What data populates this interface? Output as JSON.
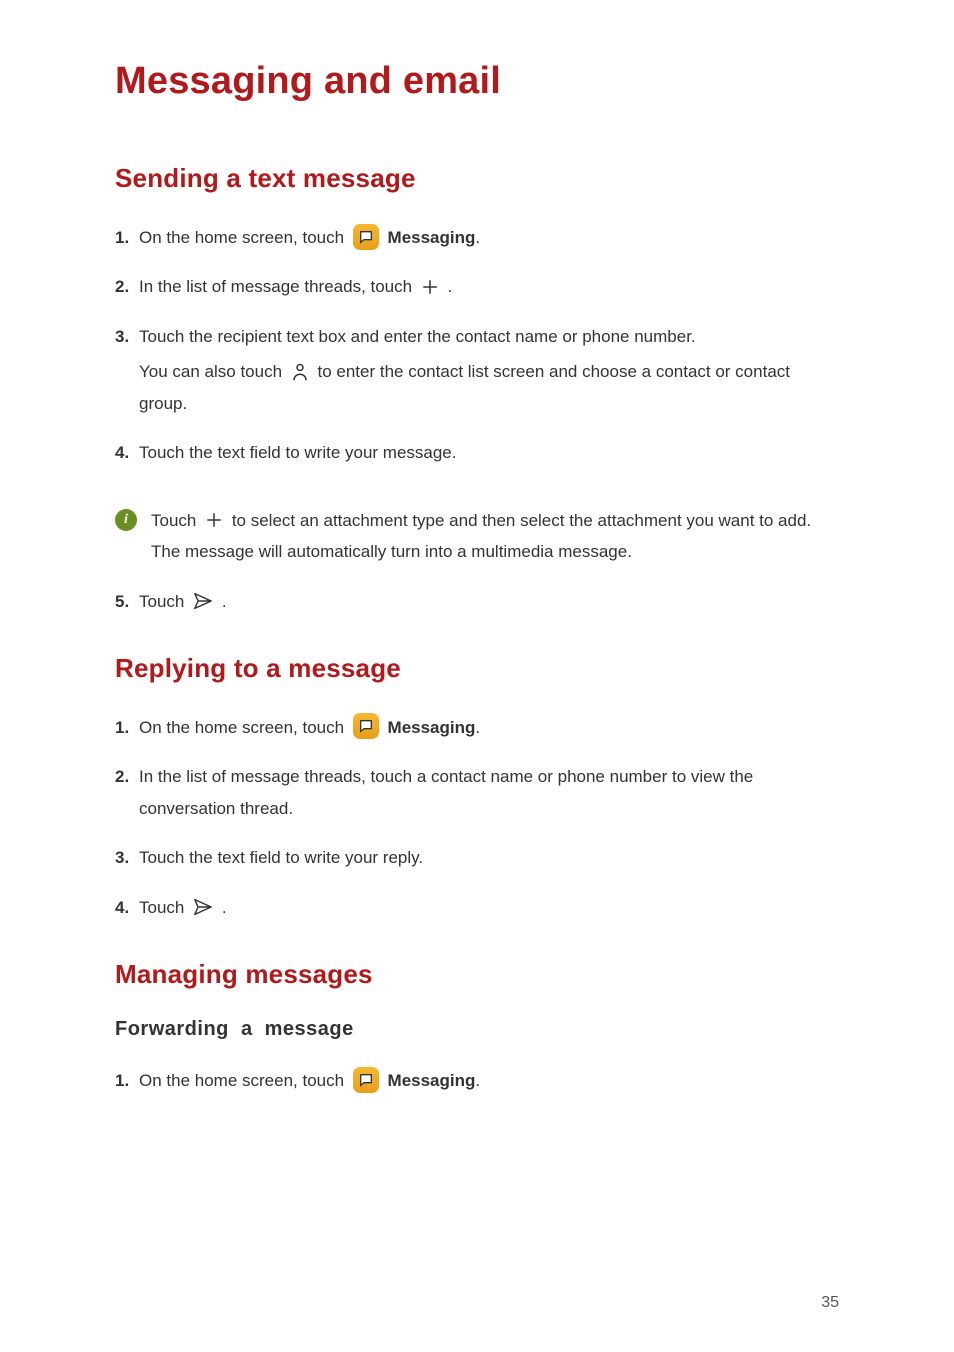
{
  "title": "Messaging and email",
  "page_number": "35",
  "section_sending": {
    "heading": "Sending a text message",
    "steps": {
      "s1_pre": "On the home screen, touch ",
      "s1_app": "Messaging",
      "s1_post": ".",
      "s2_pre": "In the list of message threads, touch ",
      "s2_post": " .",
      "s3_line1": "Touch the recipient text box and enter the contact name or phone number.",
      "s3_line2_pre": "You can also touch ",
      "s3_line2_post": " to enter the contact list screen and choose a contact or contact group.",
      "s4": "Touch the text field to write your message.",
      "note_pre": "Touch ",
      "note_post": " to select an attachment type and then select the attachment you want to add. The message will automatically turn into a multimedia message.",
      "s5_pre": "Touch ",
      "s5_post": " ."
    }
  },
  "section_replying": {
    "heading": "Replying to a message",
    "steps": {
      "s1_pre": "On the home screen, touch ",
      "s1_app": "Messaging",
      "s1_post": ".",
      "s2": "In the list of message threads, touch a contact name or phone number to view the conversation thread.",
      "s3": "Touch the text field to write your reply.",
      "s4_pre": "Touch ",
      "s4_post": " ."
    }
  },
  "section_managing": {
    "heading": "Managing messages",
    "sub_forwarding": {
      "heading": "Forwarding  a  message",
      "steps": {
        "s1_pre": "On the home screen, touch ",
        "s1_app": "Messaging",
        "s1_post": "."
      }
    }
  }
}
